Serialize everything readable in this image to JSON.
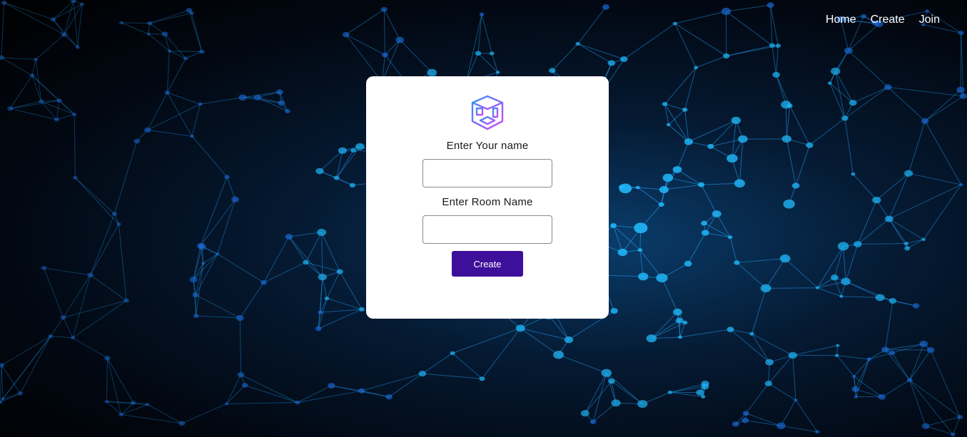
{
  "nav": {
    "home": "Home",
    "create": "Create",
    "join": "Join"
  },
  "form": {
    "logo_icon": "cube-room-icon",
    "name_label": "Enter Your name",
    "name_value": "",
    "room_label": "Enter Room Name",
    "room_value": "",
    "submit_label": "Create"
  },
  "colors": {
    "button": "#3d0f9a",
    "card": "#ffffff",
    "network_lines": "#1e90e0"
  }
}
